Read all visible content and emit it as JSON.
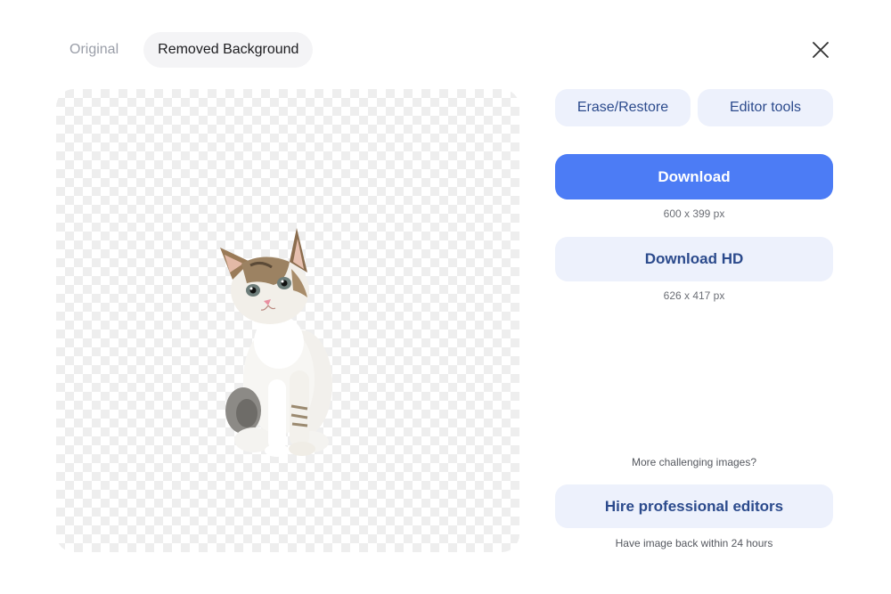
{
  "tabs": [
    {
      "label": "Original",
      "active": false
    },
    {
      "label": "Removed Background",
      "active": true
    }
  ],
  "tools": {
    "erase_restore": "Erase/Restore",
    "editor_tools": "Editor tools"
  },
  "download": {
    "label": "Download",
    "size": "600 x 399 px"
  },
  "download_hd": {
    "label": "Download HD",
    "size": "626 x 417 px"
  },
  "pro": {
    "prompt": "More challenging images?",
    "label": "Hire professional editors",
    "note": "Have image back within 24 hours"
  },
  "icons": {
    "close": "close-icon"
  },
  "colors": {
    "primary": "#4c7cf5",
    "soft_button": "#edf1fc",
    "soft_text": "#2b4a8c"
  }
}
